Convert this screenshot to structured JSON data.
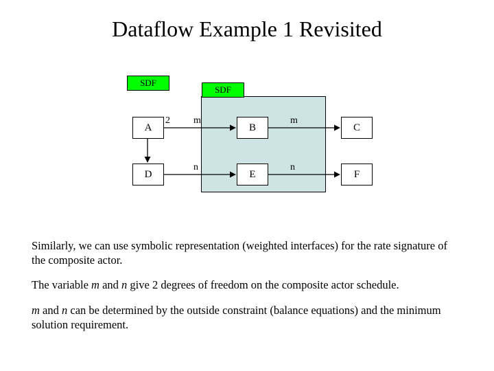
{
  "title": "Dataflow Example 1 Revisited",
  "diagram": {
    "outerLabel": "SDF",
    "innerLabel": "SDF",
    "nodes": {
      "A": "A",
      "B": "B",
      "C": "C",
      "D": "D",
      "E": "E",
      "F": "F"
    },
    "rates": {
      "A_out": "2",
      "AB": "m",
      "BC": "m",
      "DE": "n",
      "EF": "n"
    }
  },
  "text": {
    "p1a": "Similarly, we can use symbolic representation (weighted interfaces) for the rate signature of the composite actor.",
    "p2a": "The variable ",
    "p2m": "m",
    "p2b": " and ",
    "p2n": "n",
    "p2c": " give 2 degrees of freedom on the composite actor schedule.",
    "p3m": "m",
    "p3a": " and ",
    "p3n": "n",
    "p3b": " can be determined by the outside constraint (balance equations) and the minimum solution requirement."
  }
}
